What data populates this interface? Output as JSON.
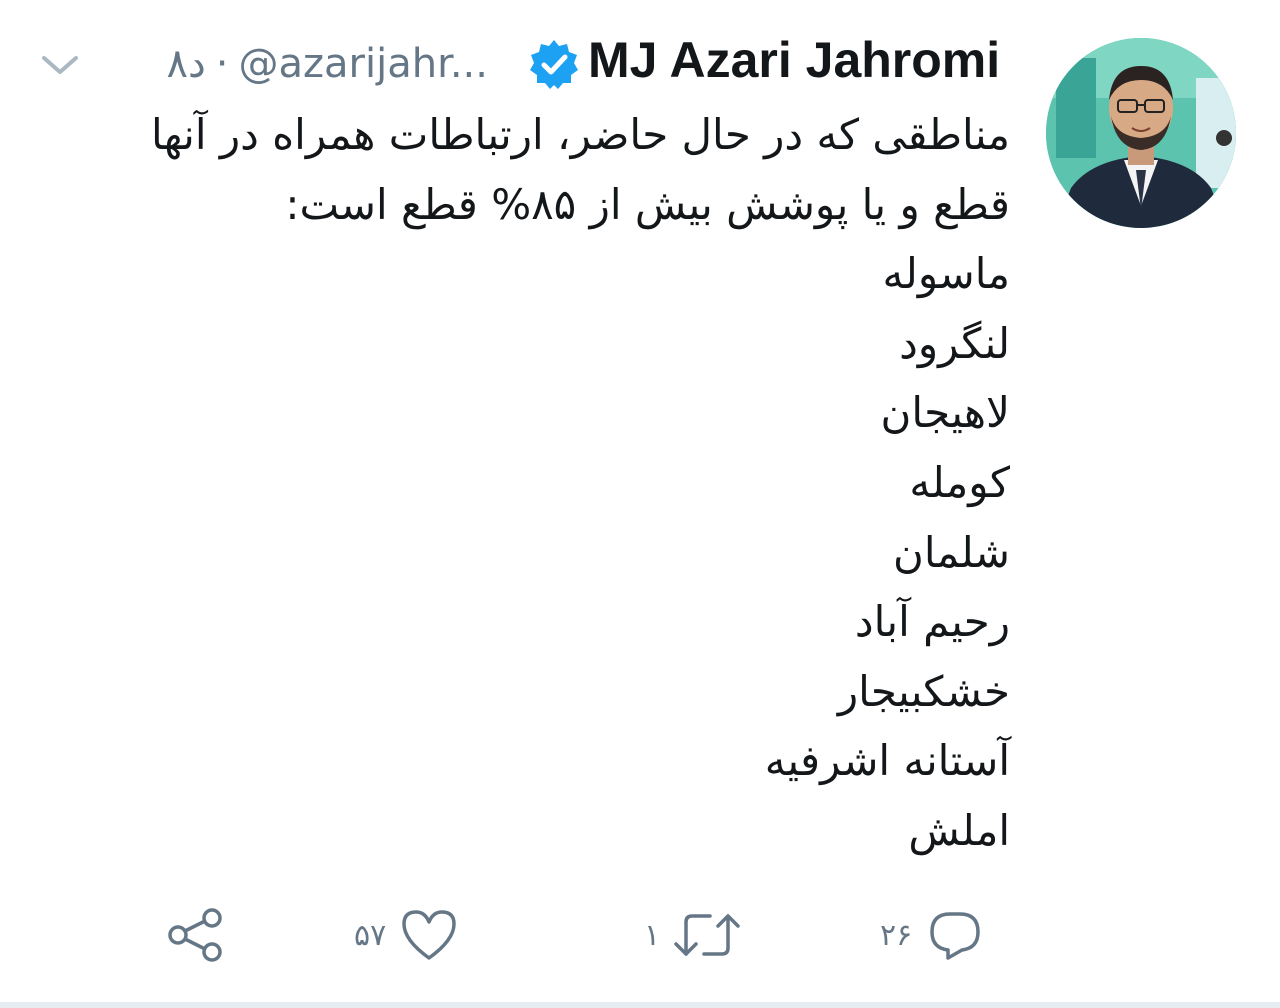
{
  "author": {
    "display_name": "MJ Azari Jahromi",
    "handle": "@azarijahr...",
    "separator": "·",
    "timestamp": "۸د",
    "verified": true
  },
  "tweet": {
    "lines": [
      "مناطقی که در حال حاضر، ارتباطات همراه در آنها",
      "قطع و یا پوشش بیش از ۸۵% قطع است:",
      "ماسوله",
      "لنگرود",
      "لاهیجان",
      "کومله",
      "شلمان",
      "رحیم آباد",
      "خشکبیجار",
      "آستانه اشرفیه",
      "املش"
    ]
  },
  "actions": {
    "reply": {
      "icon": "reply-icon",
      "count": "۲۶"
    },
    "retweet": {
      "icon": "retweet-icon",
      "count": "۱"
    },
    "like": {
      "icon": "heart-icon",
      "count": "۵۷"
    },
    "share": {
      "icon": "share-icon"
    }
  },
  "colors": {
    "text": "#14171a",
    "secondary": "#657786",
    "verified_badge": "#1da1f2",
    "divider": "#e6ecf0"
  }
}
